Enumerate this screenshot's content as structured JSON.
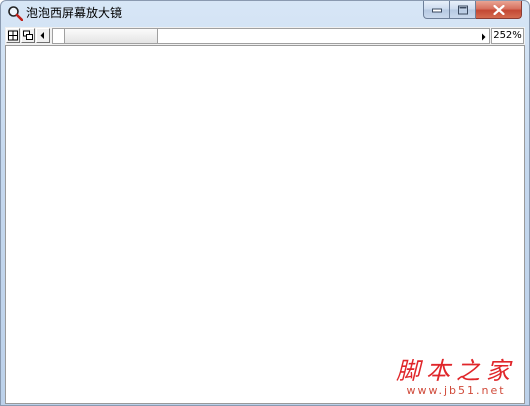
{
  "window": {
    "title": "泡泡西屏幕放大镜"
  },
  "toolbar": {
    "zoom_level": "252%"
  },
  "icons": {
    "title": "magnifier-icon",
    "grid": "grid-icon",
    "overlap": "overlap-windows-icon",
    "scroll_left": "arrow-left-icon",
    "scroll_right": "arrow-right-icon"
  },
  "watermark": {
    "main": "脚本之家",
    "sub": "www.jb51.net"
  },
  "colors": {
    "title_bar": "#c5d8ee",
    "close_button": "#c44834",
    "watermark": "#e0262a"
  }
}
